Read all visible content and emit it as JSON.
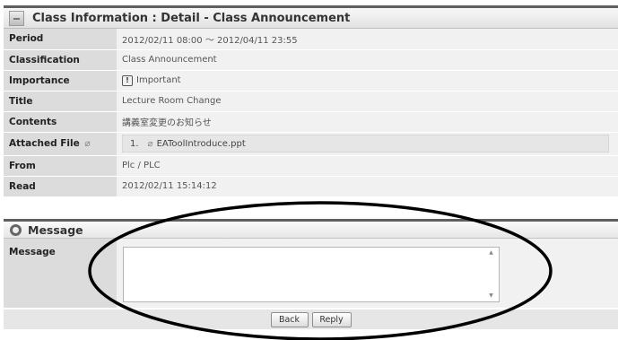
{
  "header": {
    "title": "Class Information : Detail - Class Announcement",
    "icon": "minimize-icon"
  },
  "details": {
    "period_label": "Period",
    "period_value": "2012/02/11 08:00 ～ 2012/04/11 23:55",
    "classification_label": "Classification",
    "classification_value": "Class Announcement",
    "importance_label": "Importance",
    "importance_icon": "!",
    "importance_value": "Important",
    "title_label": "Title",
    "title_value": "Lecture Room Change",
    "contents_label": "Contents",
    "contents_value": "講義室変更のお知らせ",
    "attached_label": "Attached File",
    "attached_file_index": "1.",
    "attached_file_name": "EAToolIntroduce.ppt",
    "from_label": "From",
    "from_value": "Plc / PLC",
    "read_label": "Read",
    "read_value": "2012/02/11 15:14:12"
  },
  "message": {
    "section_title": "Message",
    "field_label": "Message",
    "field_value": ""
  },
  "buttons": {
    "back": "Back",
    "reply": "Reply"
  },
  "colors": {
    "label_bg": "#dcdcdc",
    "value_bg": "#f1f1f1",
    "header_border": "#5f5f5f",
    "annotation": "#000000"
  }
}
